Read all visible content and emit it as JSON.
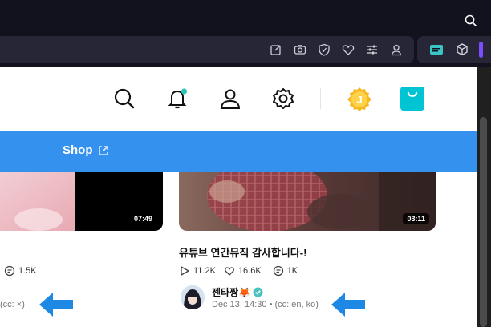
{
  "header_icons": [
    "search-icon",
    "bell-icon",
    "user-icon",
    "gear-icon"
  ],
  "notification_dot_color": "#2ec4b6",
  "coin_letter": "J",
  "nav": {
    "shop_label": "Shop"
  },
  "left_video": {
    "duration": "07:49",
    "comments": "1.5K",
    "meta": "(cc: ×)"
  },
  "right_video": {
    "duration": "03:11",
    "title": "유튜브 연간뮤직 감사합니다-!",
    "views": "11.2K",
    "likes": "16.6K",
    "comments": "1K",
    "channel": "젠타짱🦊",
    "date": "Dec 13, 14:30",
    "meta": "• (cc: en, ko)"
  },
  "colors": {
    "accent_blue": "#3591ee",
    "arrow_blue": "#1e88e5",
    "verified": "#4dc0c0"
  }
}
